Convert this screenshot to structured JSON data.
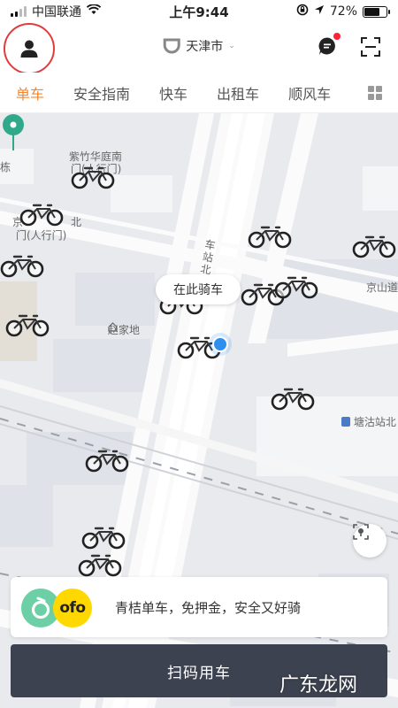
{
  "status_bar": {
    "carrier": "中国联通",
    "time": "上午9:44",
    "battery_percent": "72%",
    "battery_level": 0.72,
    "icons": [
      "signal-icon",
      "wifi-icon",
      "rotation-lock-icon",
      "location-arrow-icon",
      "battery-icon"
    ]
  },
  "header": {
    "city": "天津市",
    "avatar_icon": "person-icon",
    "logo_icon": "didi-logo-icon",
    "message_icon": "message-bubble-icon",
    "scan_icon": "scan-frame-icon",
    "accent_color": "#f7852b",
    "highlight_ring_color": "#e23b3b"
  },
  "tabs": [
    {
      "label": "单车",
      "active": true
    },
    {
      "label": "安全指南",
      "active": false
    },
    {
      "label": "快车",
      "active": false
    },
    {
      "label": "出租车",
      "active": false
    },
    {
      "label": "顺风车",
      "active": false
    }
  ],
  "map": {
    "pois": {
      "poi_1": "紫竹华庭南",
      "poi_1b": "门(人行门)",
      "poi_2": "京",
      "poi_2b": "北",
      "poi_2c": "门(人行门)",
      "poi_3": "赵家地",
      "poi_4": "塘沽站北",
      "poi_5": "京山道",
      "poi_6": "栋",
      "road_1": "车站北"
    },
    "bubble_text": "在此骑车",
    "pin_color": "#2fa98a",
    "user_dot_color": "#2e8ff0"
  },
  "promo": {
    "text": "青桔单车，免押金，安全又好骑",
    "brand_green_color": "#6ccfa5",
    "brand_yellow_color": "#ffd800",
    "ofo_text": "ofo"
  },
  "action": {
    "scan_ride_label": "扫码用车",
    "button_color": "#3d4250"
  },
  "watermark": "广东龙网"
}
